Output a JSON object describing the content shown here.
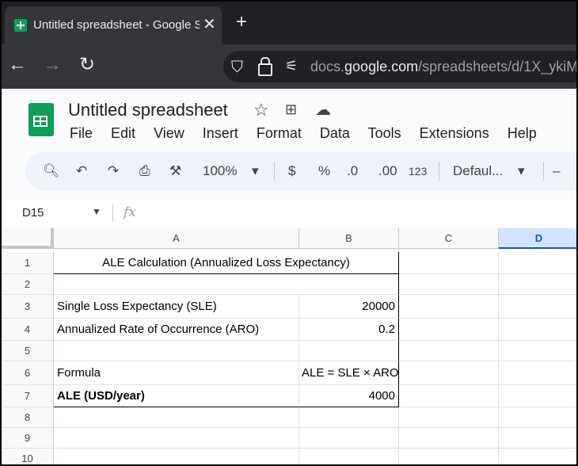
{
  "browser": {
    "tab_title": "Untitled spreadsheet - Google S",
    "url_prefix": "docs.",
    "url_host": "google.com",
    "url_path": "/spreadsheets/d/1X_ykiMU"
  },
  "app": {
    "title": "Untitled spreadsheet",
    "menu": [
      "File",
      "Edit",
      "View",
      "Insert",
      "Format",
      "Data",
      "Tools",
      "Extensions",
      "Help"
    ],
    "toolbar": {
      "zoom": "100%",
      "currency": "$",
      "percent": "%",
      "decrease_decimals": ".0",
      "increase_decimals": ".00",
      "number_format": "123",
      "font": "Defaul...",
      "minus": "–"
    },
    "name_box": "D15",
    "fx_label": "fx"
  },
  "grid": {
    "columns": [
      "A",
      "B",
      "C",
      "D"
    ],
    "selected_column": "D",
    "rows": [
      "1",
      "2",
      "3",
      "4",
      "5",
      "6",
      "7",
      "8",
      "9",
      "10"
    ],
    "cells": {
      "A1": "ALE Calculation (Annualized Loss Expectancy)",
      "A3": "Single Loss Expectancy (SLE)",
      "B3": "20000",
      "A4": "Annualized Rate of Occurrence (ARO)",
      "B4": "0.2",
      "A6": "Formula",
      "B6": "ALE = SLE × ARO",
      "A7": "ALE (USD/year)",
      "B7": "4000"
    }
  }
}
